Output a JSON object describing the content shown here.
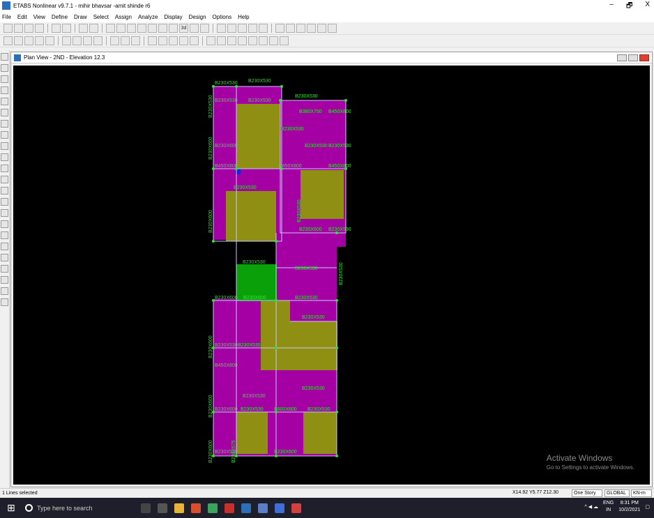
{
  "window": {
    "title": "ETABS Nonlinear v9.7.1 - mihir bhavsar -amit shinde r6",
    "minimize": "–",
    "maximize": "🗗",
    "close": "X"
  },
  "menu": [
    "File",
    "Edit",
    "View",
    "Define",
    "Draw",
    "Select",
    "Assign",
    "Analyze",
    "Display",
    "Design",
    "Options",
    "Help"
  ],
  "toolbar": {
    "render_3d": "3d"
  },
  "plan_window": {
    "title": "Plan View - 2ND - Elevation 12.3"
  },
  "beam_labels": {
    "b230x530": "B230X530",
    "b230x600": "B230X600",
    "b380x750": "B380X750",
    "b450x800": "B450X800",
    "b230x675": "B230X675",
    "b600x600": "B600X600"
  },
  "watermark": {
    "line1": "Activate Windows",
    "line2": "Go to Settings to activate Windows."
  },
  "status": {
    "selection": "1 Lines selected",
    "coords": "X14.92  Y5.77  Z12.30",
    "story_mode": "One Story",
    "coord_system": "GLOBAL",
    "units": "KN-m"
  },
  "taskbar": {
    "search_placeholder": "Type here to search",
    "lang": "ENG",
    "region": "IN",
    "time": "8:31 PM",
    "date": "10/2/2021"
  },
  "colors": {
    "slab": "#a400a4",
    "opening": "#8f8f14",
    "highlight": "#0aa00a",
    "beam_label": "#2fe52f",
    "canvas": "#000000"
  }
}
